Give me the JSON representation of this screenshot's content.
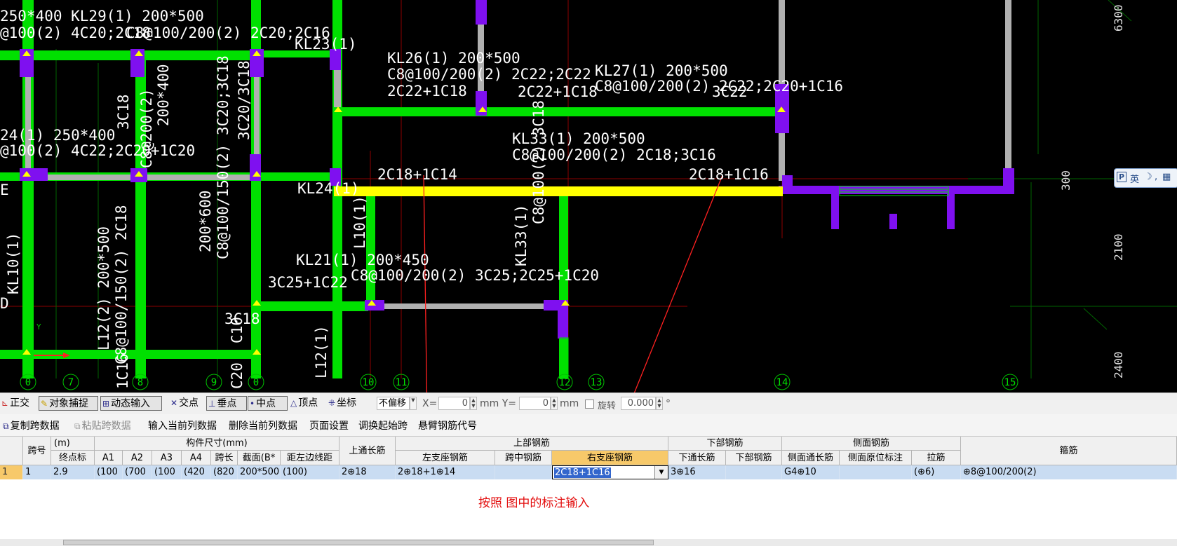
{
  "cad": {
    "labels": {
      "t1": "250*400 KL29(1) 200*500",
      "t2": "@100(2) 4C20;2C18",
      "t3": "C8@100/200(2) 2C20;2C16",
      "t4": "KL23(1)",
      "t5": "KL26(1) 200*500",
      "t6": "C8@100/200(2) 2C22;2C22",
      "t7": "2C22+1C18",
      "t8": "KL27(1) 200*500",
      "t9": "C8@100/200(2) 2C22;2C20+1C16",
      "t10": "2C22+1C18",
      "t11": "3C22",
      "t12": "3C18",
      "t13": "200*400",
      "t14": "24(1) 250*400",
      "t15": "@100(2) 4C22;2C20+1C20",
      "t16": "KL33(1) 200*500",
      "t17": "C8@100/200(2) 2C18;3C16",
      "t18": "2C18+1C14",
      "t19": "2C18+1C16",
      "t20": "KL24(1)",
      "t21": "KL21(1) 200*450",
      "t22": "3C25+1C22",
      "t23": "C8@100/200(2) 3C25;2C25+1C20",
      "t24": "L10(1)",
      "t25": "KL33(1)",
      "t26": "C8@100(2) 3C18",
      "t27": "200*600",
      "t28": "C8@100/150(2) 3C20;3C18",
      "t29": "3C20/3C18",
      "t30": "L12(2) 200*500",
      "t31": "C8@100/150(2) 2C18",
      "t32": "L10(1)",
      "t33": "L12(1)",
      "t34": "3C18",
      "t35": "C10",
      "t36": "1C16",
      "t37": "C20",
      "t38": "200*500",
      "t39": "3C18",
      "t40": "2C18",
      "t41": "2C18",
      "t42": "C8@200(2)",
      "t43": "200*400",
      "t44": "KL",
      "t45": "10",
      "t46": "KL10(1)"
    },
    "axes": [
      "0",
      "7",
      "8",
      "9",
      "0",
      "10",
      "11",
      "12",
      "13",
      "14",
      "15"
    ],
    "dims": [
      "6300",
      "300",
      "2100",
      "2400"
    ],
    "side_marks": [
      "E",
      "D",
      "Y"
    ]
  },
  "ime": {
    "p_label": "P",
    "lang": "英",
    "moon": "☽",
    "comma": ",",
    "grid_icon": "▦"
  },
  "snapbar": {
    "ortho": "正交",
    "object_snap": "对象捕捉",
    "dynamic_input": "动态输入",
    "intersection": "交点",
    "perpendicular": "垂点",
    "midpoint": "中点",
    "vertex": "顶点",
    "coordinate": "坐标",
    "offset_mode": "不偏移",
    "x_label": "X=",
    "x_value": "0",
    "y_label": "mm Y=",
    "y_value": "0",
    "mm_label": "mm",
    "rotate_label": "旋转",
    "rotate_value": "0.000",
    "degree": "°"
  },
  "toolbar": {
    "copy_span": "复制跨数据",
    "paste_span": "粘贴跨数据",
    "input_col": "输入当前列数据",
    "delete_col": "删除当前列数据",
    "page_setup": "页面设置",
    "swap_start": "调换起始跨",
    "cantilever": "悬臂钢筋代号"
  },
  "table": {
    "headers": {
      "span_no": "跨号",
      "unit_m": "(m)",
      "end_elev": "终点标",
      "size_group": "构件尺寸(mm)",
      "a1": "A1",
      "a2": "A2",
      "a3": "A3",
      "a4": "A4",
      "span_len": "跨长",
      "section": "截面(B*",
      "left_dist": "距左边线距",
      "top_through": "上通长筋",
      "top_group": "上部钢筋",
      "left_support": "左支座钢筋",
      "mid_span": "跨中钢筋",
      "right_support": "右支座钢筋",
      "bottom_group": "下部钢筋",
      "bottom_through": "下通长筋",
      "bottom_bar": "下部钢筋",
      "side_group": "侧面钢筋",
      "side_through": "侧面通长筋",
      "side_orig": "侧面原位标注",
      "tie": "拉筋",
      "stirrup": "箍筋"
    },
    "row": {
      "idx": "1",
      "span": "1",
      "elev": "2.9",
      "a1": "(100",
      "a2": "(700",
      "a3": "(100",
      "a4": "(420",
      "len": "(820",
      "section": "200*500",
      "left_dist": "(100)",
      "top_through": "2⊕18",
      "left_support": "2⊕18+1⊕14",
      "mid_span": "",
      "right_support": "2C18+1C16",
      "bottom_through": "3⊕16",
      "bottom_bar": "",
      "side_through": "G4⊕10",
      "side_orig": "",
      "tie": "(⊕6)",
      "stirrup": "⊕8@100/200(2)"
    }
  },
  "annotation": "按照 图中的标注输入"
}
